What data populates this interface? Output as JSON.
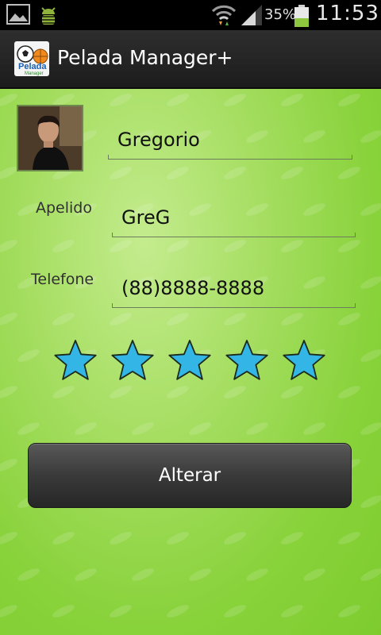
{
  "status_bar": {
    "battery_percent": "35%",
    "time": "11:53",
    "icons": [
      "gallery-icon",
      "android-debug-icon",
      "wifi-icon",
      "signal-icon",
      "battery-icon"
    ]
  },
  "action_bar": {
    "title": "Pelada Manager+",
    "logo_text": "Pelada",
    "logo_subtext": "Manager"
  },
  "form": {
    "name_value": "Gregorio",
    "apelido_label": "Apelido",
    "apelido_value": "GreG",
    "telefone_label": "Telefone",
    "telefone_value": "(88)8888-8888",
    "rating": 5,
    "rating_max": 5
  },
  "buttons": {
    "alterar_label": "Alterar"
  },
  "colors": {
    "background_green": "#8fd444",
    "star_fill": "#33b5e5",
    "button_dark": "#3a3a3a"
  }
}
